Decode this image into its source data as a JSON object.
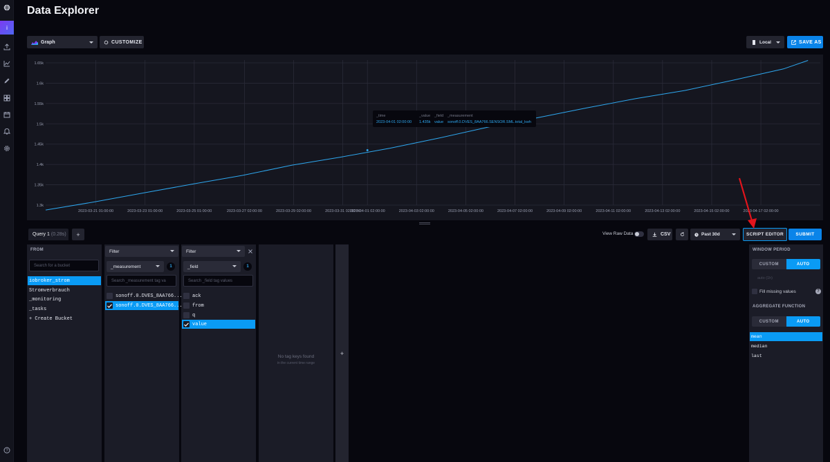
{
  "page": {
    "title": "Data Explorer"
  },
  "nav": {
    "items": [
      {
        "name": "logo-icon"
      },
      {
        "name": "user-icon",
        "label": "i"
      },
      {
        "name": "upload-icon"
      },
      {
        "name": "graph-icon"
      },
      {
        "name": "pencil-icon"
      },
      {
        "name": "dashboard-icon"
      },
      {
        "name": "calendar-icon"
      },
      {
        "name": "bell-icon"
      },
      {
        "name": "gear-icon"
      },
      {
        "name": "help-icon"
      }
    ]
  },
  "toolbar": {
    "graph_type": "Graph",
    "customize": "CUSTOMIZE",
    "timezone": "Local",
    "save_as": "SAVE AS"
  },
  "chart_data": {
    "type": "line",
    "y_ticks": [
      "1.65k",
      "1.6k",
      "1.55k",
      "1.5k",
      "1.45k",
      "1.4k",
      "1.35k",
      "1.3k"
    ],
    "x_ticks": [
      "2023-03-21 01:00:00",
      "2023-03-23 01:00:00",
      "2023-03-25 01:00:00",
      "2023-03-27 02:00:00",
      "2023-03-29 02:00:00",
      "2023-03-31 02:00:00",
      "2023-04-01 02:00:00",
      "2023-04-03 02:00:00",
      "2023-04-05 02:00:00",
      "2023-04-07 02:00:00",
      "2023-04-09 02:00:00",
      "2023-04-11 02:00:00",
      "2023-04-13 02:00:00",
      "2023-04-15 02:00:00",
      "2023-04-17 02:00:00"
    ],
    "ylim": [
      1290,
      1655
    ],
    "x": [
      "2023-03-19",
      "2023-03-21",
      "2023-03-23",
      "2023-03-25",
      "2023-03-27",
      "2023-03-29",
      "2023-03-31",
      "2023-04-02",
      "2023-04-04",
      "2023-04-06",
      "2023-04-08",
      "2023-04-10",
      "2023-04-12",
      "2023-04-14",
      "2023-04-16",
      "2023-04-18",
      "2023-04-19"
    ],
    "values": [
      1288,
      1308,
      1330,
      1352,
      1373,
      1398,
      1418,
      1440,
      1465,
      1492,
      1515,
      1539,
      1562,
      1582,
      1608,
      1635,
      1656
    ],
    "color": "#2ea8f0",
    "grid": true
  },
  "tooltip": {
    "headers": {
      "time": "_time",
      "value": "_value",
      "field": "_field",
      "measurement": "_measurement"
    },
    "values": {
      "time": "2023-04-01 02:00:00",
      "value": "1.435k",
      "field": "value",
      "measurement": "sonoff.0.DVES_8AA766.SENSOR.SML.total_kwh"
    }
  },
  "query_bar": {
    "tab_label": "Query 1",
    "tab_time": "(0.28s)",
    "add": "+",
    "view_raw": "View Raw Data",
    "csv": "CSV",
    "time_range": "Past 30d",
    "script_editor": "SCRIPT EDITOR",
    "submit": "SUBMIT"
  },
  "from_panel": {
    "label": "FROM",
    "search_placeholder": "Search for a bucket",
    "buckets": [
      "iobroker_strom",
      "Stromverbrauch",
      "_monitoring",
      "_tasks",
      "+ Create Bucket"
    ]
  },
  "filter1": {
    "mode": "Filter",
    "key": "_measurement",
    "count": "1",
    "search_placeholder": "Search _measurement tag va",
    "items": [
      "sonoff.0.DVES_8AA766...",
      "sonoff.0.DVES_8AA766..."
    ]
  },
  "filter2": {
    "mode": "Filter",
    "key": "_field",
    "count": "1",
    "search_placeholder": "Search _field tag values",
    "items": [
      "ack",
      "from",
      "q",
      "value"
    ]
  },
  "filter3": {
    "empty_title": "No tag keys found",
    "empty_sub": "in the current time range",
    "add": "+"
  },
  "aggregate": {
    "window_label": "WINDOW PERIOD",
    "custom": "CUSTOM",
    "auto": "AUTO",
    "window_value": "auto (1h)",
    "fill_missing": "Fill missing values",
    "help": "?",
    "function_label": "AGGREGATE FUNCTION",
    "functions": [
      "mean",
      "median",
      "last"
    ]
  }
}
